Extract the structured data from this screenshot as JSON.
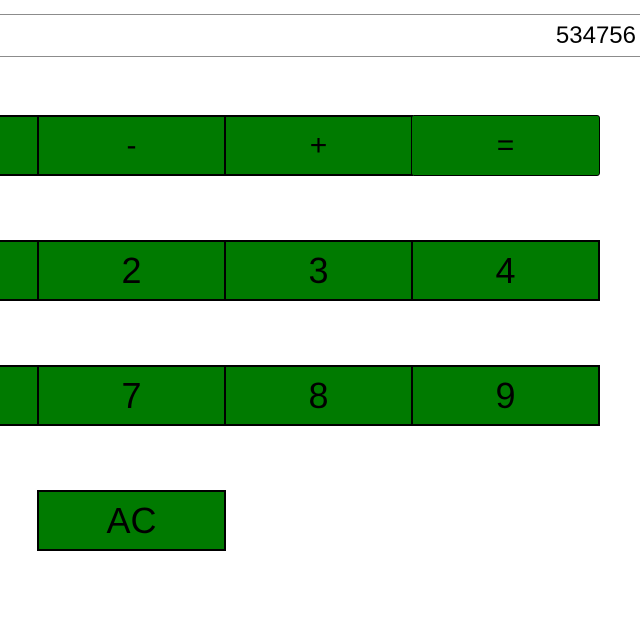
{
  "display": {
    "value": "534756"
  },
  "keys": {
    "row1": {
      "left_partial": "",
      "minus": "-",
      "plus": "+",
      "equals": "="
    },
    "row2": {
      "left_partial": "",
      "two": "2",
      "three": "3",
      "four": "4"
    },
    "row3": {
      "left_partial": "",
      "seven": "7",
      "eight": "8",
      "nine": "9"
    },
    "row4": {
      "clear": "AC"
    }
  },
  "colors": {
    "key_background": "#007a00",
    "key_border": "#000000",
    "display_border": "#8c8c8c"
  }
}
